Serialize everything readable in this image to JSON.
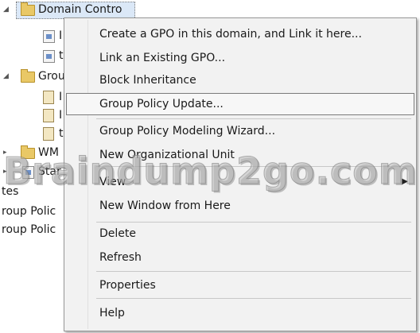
{
  "tree": {
    "domain_controllers": "Domain Contro",
    "gpo_1": "I",
    "gpo_2": "t",
    "group_policy_objects": "Grou",
    "obj_1": "I",
    "obj_2": "I",
    "obj_3": "t",
    "wmi_filters": "WM",
    "starter": "Star",
    "sites": "tes",
    "modeling": "roup Polic",
    "results": "roup Polic"
  },
  "context_menu": {
    "items": [
      {
        "label": "Create a GPO in this domain, and Link it here..."
      },
      {
        "label": "Link an Existing GPO..."
      },
      {
        "label": "Block Inheritance"
      },
      {
        "label": "Group Policy Update..."
      },
      {
        "label": "Group Policy Modeling Wizard..."
      },
      {
        "label": "New Organizational Unit"
      },
      {
        "label": "View"
      },
      {
        "label": "New Window from Here"
      },
      {
        "label": "Delete"
      },
      {
        "label": "Refresh"
      },
      {
        "label": "Properties"
      },
      {
        "label": "Help"
      }
    ],
    "submenu_arrow": "▶"
  },
  "watermark": "Braindump2go.com",
  "icons": {
    "expander": "▸",
    "expander_open": "◢"
  }
}
